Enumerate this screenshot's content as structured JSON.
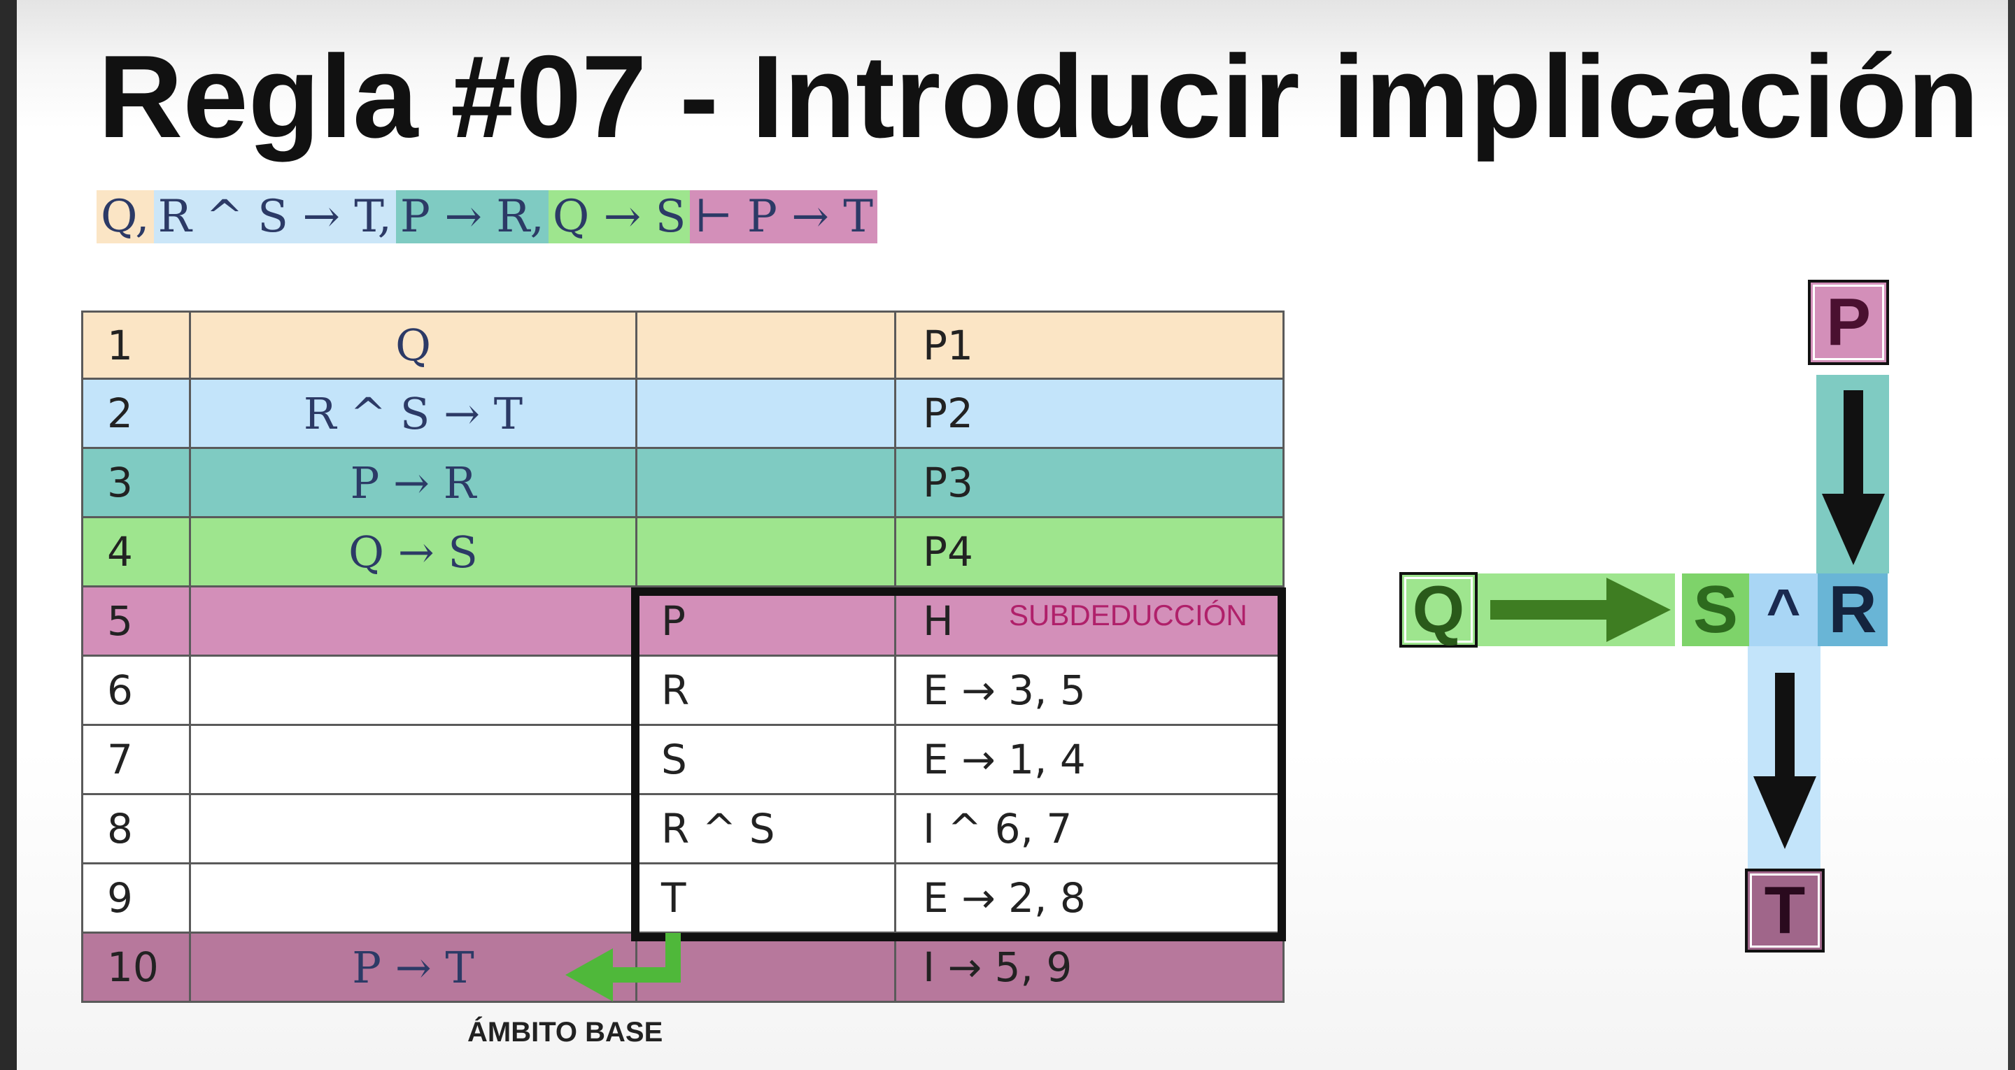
{
  "title": "Regla #07 - Introducir implicación",
  "formula": {
    "parts": [
      "Q,",
      "R ^ S → T,",
      "P → R,",
      "Q → S",
      "⊢ P → T"
    ]
  },
  "colors": {
    "premise1": "#fbe5c5",
    "premise2": "#cbe6f8",
    "premise3": "#7fcbc2",
    "premise4": "#9ee58e",
    "hypothesis": "#d38fb9",
    "conclusion": "#b7789c",
    "arrow_green": "#3e7d22",
    "subdeduction_label": "#b0206a"
  },
  "proof": {
    "rows": [
      {
        "num": "1",
        "main": "Q",
        "sub": "",
        "just": "P1"
      },
      {
        "num": "2",
        "main": "R ^ S → T",
        "sub": "",
        "just": "P2"
      },
      {
        "num": "3",
        "main": "P → R",
        "sub": "",
        "just": "P3"
      },
      {
        "num": "4",
        "main": "Q → S",
        "sub": "",
        "just": "P4"
      },
      {
        "num": "5",
        "main": "",
        "sub": "P",
        "just": "H"
      },
      {
        "num": "6",
        "main": "",
        "sub": "R",
        "just": "E → 3, 5"
      },
      {
        "num": "7",
        "main": "",
        "sub": "S",
        "just": "E → 1, 4"
      },
      {
        "num": "8",
        "main": "",
        "sub": "R ^ S",
        "just": "I ^ 6, 7"
      },
      {
        "num": "9",
        "main": "",
        "sub": "T",
        "just": "E → 2, 8"
      },
      {
        "num": "10",
        "main": "P → T",
        "sub": "",
        "just": "I → 5, 9"
      }
    ],
    "subdeduction_label": "SUBDEDUCCIÓN",
    "base_label": "ÁMBITO BASE"
  },
  "diagram": {
    "p": "P",
    "q": "Q",
    "s": "S",
    "and": "^",
    "r": "R",
    "t": "T"
  }
}
